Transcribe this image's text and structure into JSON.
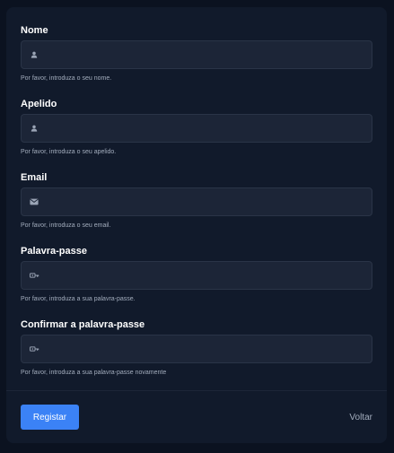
{
  "form": {
    "fields": [
      {
        "label": "Nome",
        "icon": "user-icon",
        "value": "",
        "help": "Por favor, introduza o seu nome."
      },
      {
        "label": "Apelido",
        "icon": "user-icon",
        "value": "",
        "help": "Por favor, introduza o seu apelido."
      },
      {
        "label": "Email",
        "icon": "envelope-icon",
        "value": "",
        "help": "Por favor, introduza o seu email."
      },
      {
        "label": "Palavra-passe",
        "icon": "key-icon",
        "value": "",
        "help": "Por favor, introduza a sua palavra-passe."
      },
      {
        "label": "Confirmar a palavra-passe",
        "icon": "key-icon",
        "value": "",
        "help": "Por favor, introduza a sua palavra-passe novamente"
      }
    ]
  },
  "actions": {
    "submit_label": "Registar",
    "back_label": "Voltar"
  },
  "colors": {
    "background": "#0b1220",
    "card": "#111a2b",
    "input_bg": "#1c2537",
    "input_border": "#2a3447",
    "accent": "#3b82f6",
    "muted_text": "#a3adbd"
  }
}
